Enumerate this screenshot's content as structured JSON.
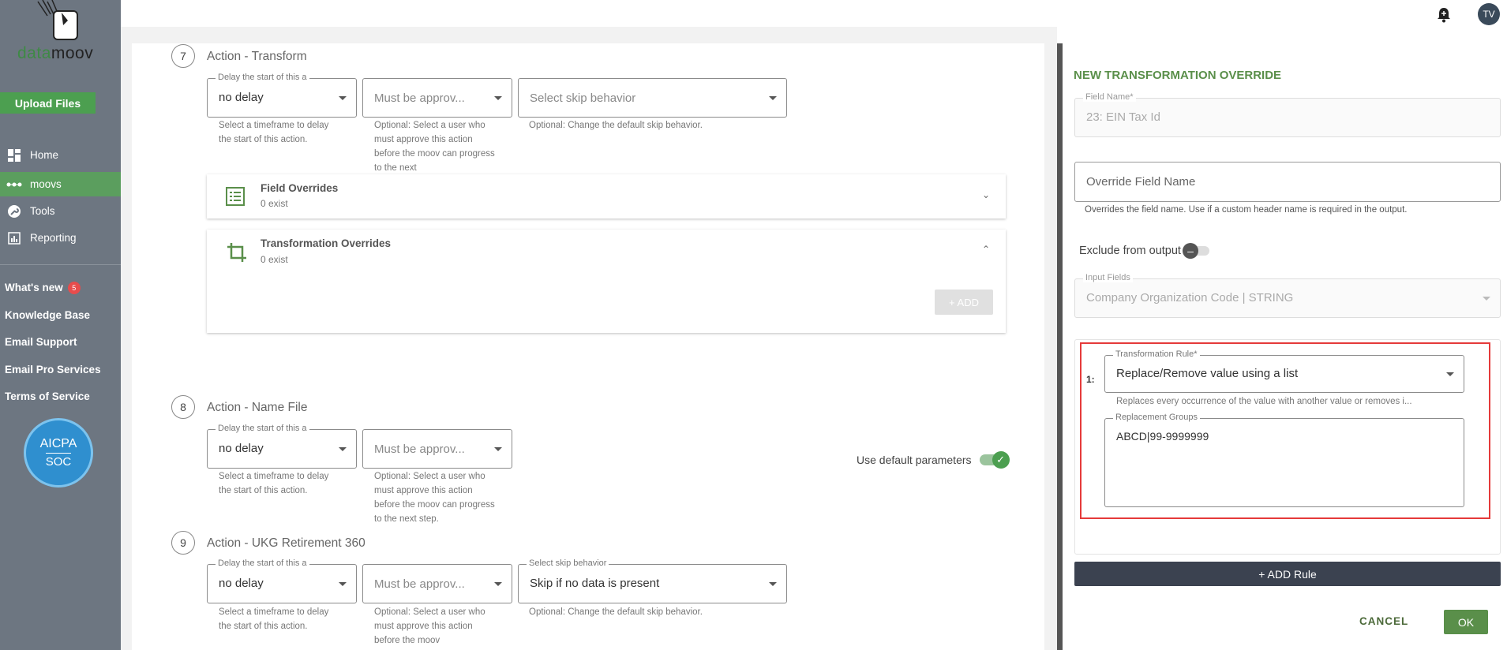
{
  "sidebar": {
    "logo_green": "data",
    "logo_dark": "moov",
    "upload_label": "Upload Files",
    "nav": [
      {
        "label": "Home",
        "icon": "grid-icon"
      },
      {
        "label": "moovs",
        "icon": "dots-icon",
        "active": true
      },
      {
        "label": "Tools",
        "icon": "wrench-icon"
      },
      {
        "label": "Reporting",
        "icon": "chart-icon"
      }
    ],
    "links": {
      "whats_new": "What's new",
      "whats_new_badge": "5",
      "knowledge_base": "Knowledge Base",
      "email_support": "Email Support",
      "email_pro": "Email Pro Services",
      "terms": "Terms of Service"
    },
    "aicpa": {
      "line1": "AICPA",
      "line2": "SOC"
    }
  },
  "topbar": {
    "avatar": "TV"
  },
  "steps": {
    "s7": {
      "num": "7",
      "title": "Action - Transform",
      "delay_label": "Delay the start of this a",
      "delay_value": "no delay",
      "delay_help": "Select a timeframe to delay the start of this action.",
      "approver_ph": "Must be approv...",
      "approver_help": "Optional: Select a user who must approve this action before the moov can progress to the next",
      "skip_ph": "Select skip behavior",
      "skip_help": "Optional: Change the default skip behavior."
    },
    "field_overrides": {
      "title": "Field Overrides",
      "sub": "0 exist"
    },
    "transformation_overrides": {
      "title": "Transformation Overrides",
      "sub": "0 exist",
      "add": "+ ADD"
    },
    "s8": {
      "num": "8",
      "title": "Action - Name File",
      "delay_label": "Delay the start of this a",
      "delay_value": "no delay",
      "delay_help": "Select a timeframe to delay the start of this action.",
      "approver_ph": "Must be approv...",
      "approver_help": "Optional: Select a user who must approve this action before the moov can progress to the next step.",
      "default_params": "Use default parameters"
    },
    "s9": {
      "num": "9",
      "title": "Action - UKG Retirement 360",
      "delay_label": "Delay the start of this a",
      "delay_value": "no delay",
      "delay_help": "Select a timeframe to delay the start of this action.",
      "approver_ph": "Must be approv...",
      "approver_help": "Optional: Select a user who must approve this action before the moov",
      "skip_label": "Select skip behavior",
      "skip_value": "Skip if no data is present",
      "skip_help": "Optional: Change the default skip behavior."
    }
  },
  "panel": {
    "title": "NEW TRANSFORMATION OVERRIDE",
    "field_name_label": "Field Name*",
    "field_name_value": "23: EIN Tax Id",
    "override_ph": "Override Field Name",
    "override_help": "Overrides the field name. Use if a custom header name is required in the output.",
    "exclude_label": "Exclude from output",
    "input_fields_label": "Input Fields",
    "input_fields_value": "Company Organization Code | STRING",
    "rule_index": "1:",
    "rule_label": "Transformation Rule*",
    "rule_value": "Replace/Remove value using a list",
    "rule_help": "Replaces every occurrence of the value with another value or removes i...",
    "groups_label": "Replacement Groups",
    "groups_value": "ABCD|99-9999999",
    "add_rule": "+ ADD Rule",
    "cancel": "CANCEL",
    "ok": "OK"
  }
}
